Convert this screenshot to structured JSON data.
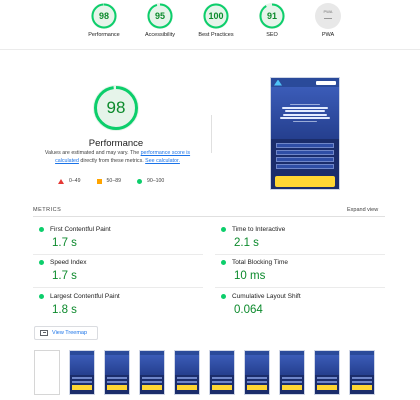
{
  "categories": [
    {
      "label": "Performance",
      "score": "98"
    },
    {
      "label": "Accessibility",
      "score": "95"
    },
    {
      "label": "Best Practices",
      "score": "100"
    },
    {
      "label": "SEO",
      "score": "91"
    },
    {
      "label": "PWA",
      "score": "",
      "badge": "PWA",
      "dash": "—"
    }
  ],
  "summary": {
    "score": "98",
    "score_fraction": 0.98,
    "title": "Performance",
    "disclaimer_prefix": "Values are estimated and may vary. The ",
    "disclaimer_link1": "performance score is calculated",
    "disclaimer_mid": " directly from these metrics. ",
    "disclaimer_link2": "See calculator.",
    "legend": [
      "0–49",
      "50–89",
      "90–100"
    ]
  },
  "colors": {
    "pass": "#0cce6b",
    "pass_text": "#0c8a2c",
    "average": "#ffa400",
    "fail": "#e53935",
    "link": "#1a73e8"
  },
  "metrics": {
    "label": "METRICS",
    "expand": "Expand view",
    "items": [
      {
        "name": "First Contentful Paint",
        "value": "1.7 s"
      },
      {
        "name": "Time to Interactive",
        "value": "2.1 s"
      },
      {
        "name": "Speed Index",
        "value": "1.7 s"
      },
      {
        "name": "Total Blocking Time",
        "value": "10 ms"
      },
      {
        "name": "Largest Contentful Paint",
        "value": "1.8 s"
      },
      {
        "name": "Cumulative Layout Shift",
        "value": "0.064"
      }
    ]
  },
  "treemap": {
    "label": "View Treemap"
  },
  "filmstrip_frames": 10
}
